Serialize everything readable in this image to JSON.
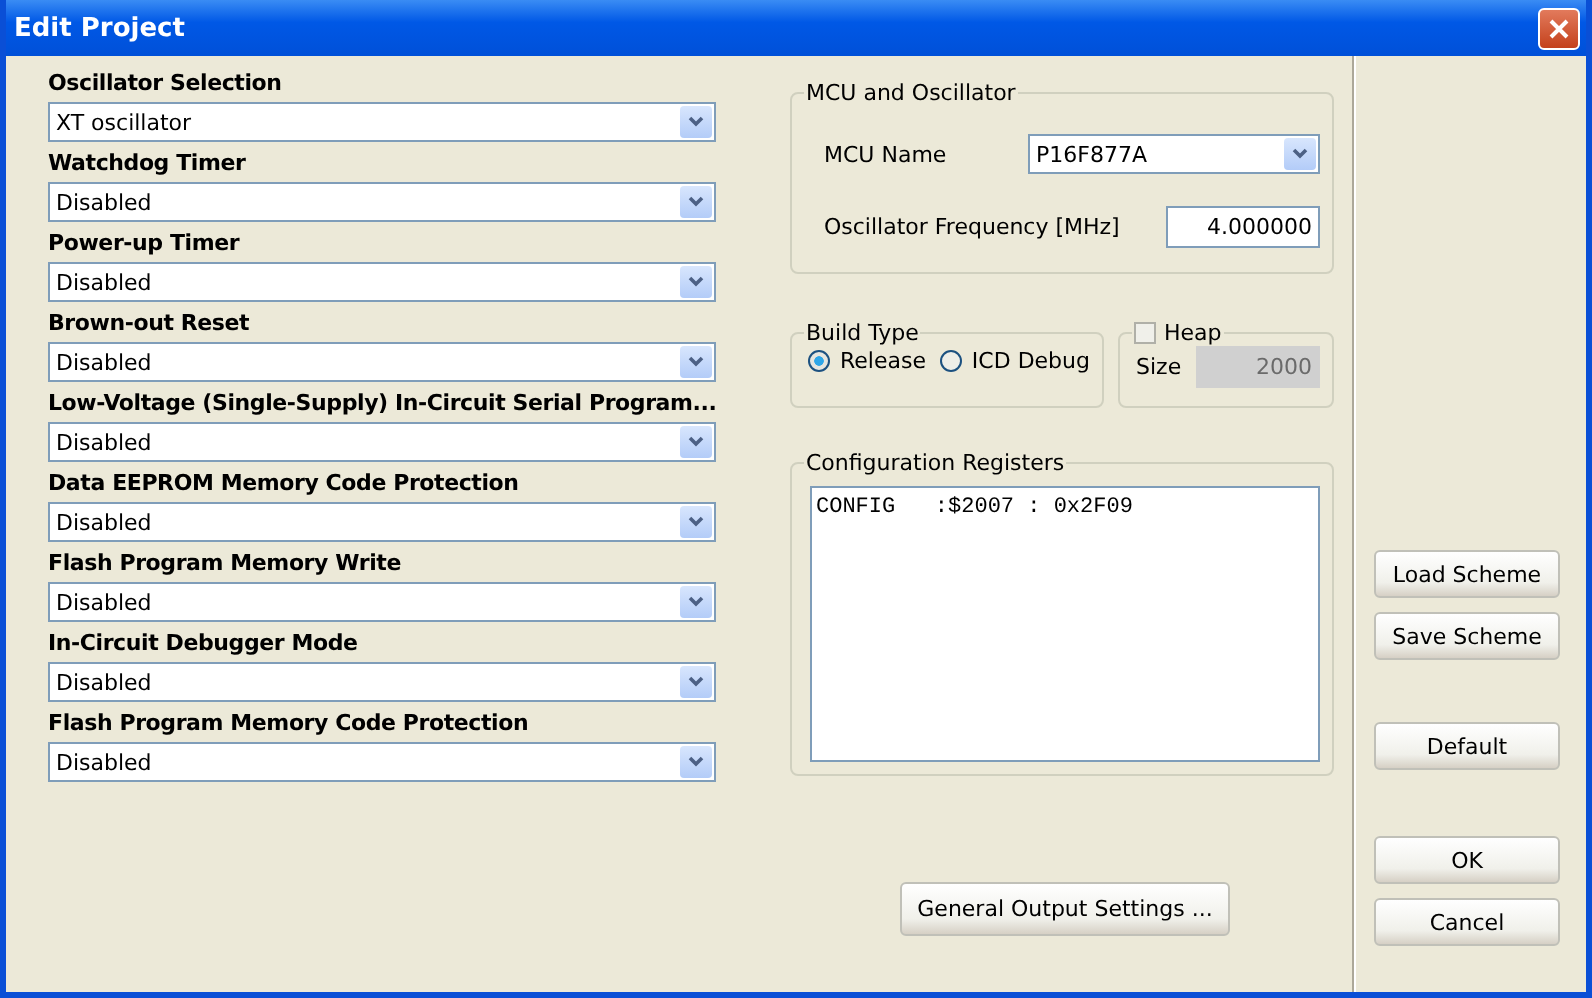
{
  "window": {
    "title": "Edit Project"
  },
  "settings": [
    {
      "label": "Oscillator Selection",
      "value": "XT oscillator"
    },
    {
      "label": "Watchdog Timer",
      "value": "Disabled"
    },
    {
      "label": "Power-up Timer",
      "value": "Disabled"
    },
    {
      "label": "Brown-out Reset",
      "value": "Disabled"
    },
    {
      "label": "Low-Voltage (Single-Supply) In-Circuit Serial Program...",
      "value": "Disabled"
    },
    {
      "label": "Data EEPROM Memory Code Protection",
      "value": "Disabled"
    },
    {
      "label": "Flash Program Memory Write",
      "value": "Disabled"
    },
    {
      "label": "In-Circuit Debugger Mode",
      "value": "Disabled"
    },
    {
      "label": "Flash Program Memory Code Protection",
      "value": "Disabled"
    }
  ],
  "mcu_group": {
    "title": "MCU and Oscillator",
    "mcu_name_label": "MCU Name",
    "mcu_name": "P16F877A",
    "frequency_label": "Oscillator Frequency [MHz]",
    "frequency": "4.000000"
  },
  "build_type": {
    "title": "Build Type",
    "options": [
      {
        "label": "Release",
        "selected": true
      },
      {
        "label": "ICD Debug",
        "selected": false
      }
    ]
  },
  "heap": {
    "title": "Heap",
    "checked": false,
    "size_label": "Size",
    "size": "2000",
    "disabled": true
  },
  "config": {
    "title": "Configuration Registers",
    "text": "CONFIG   :$2007 : 0x2F09"
  },
  "general_button": "General Output Settings ...",
  "side_buttons": {
    "scheme": [
      "Load Scheme",
      "Save Scheme"
    ],
    "default": "Default",
    "dialog": [
      "OK",
      "Cancel"
    ]
  }
}
